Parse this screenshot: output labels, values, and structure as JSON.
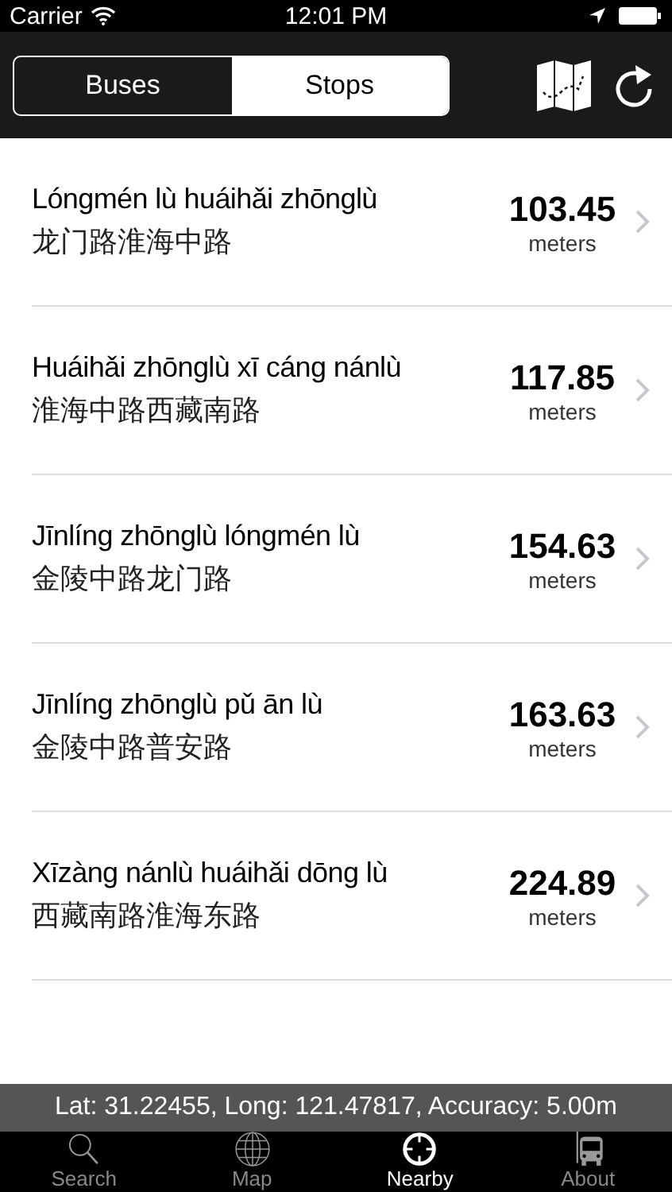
{
  "status_bar": {
    "carrier": "Carrier",
    "time": "12:01 PM"
  },
  "segments": [
    {
      "label": "Buses",
      "selected": false
    },
    {
      "label": "Stops",
      "selected": true
    }
  ],
  "stops": [
    {
      "pinyin": "Lóngmén lù huáihǎi zhōnglù",
      "hanzi": "龙门路淮海中路",
      "distance": "103.45",
      "unit": "meters"
    },
    {
      "pinyin": "Huáihǎi zhōnglù xī cáng nánlù",
      "hanzi": "淮海中路西藏南路",
      "distance": "117.85",
      "unit": "meters"
    },
    {
      "pinyin": "Jīnlíng zhōnglù lóngmén lù",
      "hanzi": "金陵中路龙门路",
      "distance": "154.63",
      "unit": "meters"
    },
    {
      "pinyin": "Jīnlíng zhōnglù pǔ ān lù",
      "hanzi": "金陵中路普安路",
      "distance": "163.63",
      "unit": "meters"
    },
    {
      "pinyin": "Xīzàng nánlù huáihǎi dōng lù",
      "hanzi": "西藏南路淮海东路",
      "distance": "224.89",
      "unit": "meters"
    }
  ],
  "location_bar": "Lat: 31.22455, Long: 121.47817, Accuracy: 5.00m",
  "tabs": [
    {
      "kind": "search",
      "label": "Search",
      "selected": false
    },
    {
      "kind": "map",
      "label": "Map",
      "selected": false
    },
    {
      "kind": "nearby",
      "label": "Nearby",
      "selected": true
    },
    {
      "kind": "about",
      "label": "About",
      "selected": false
    }
  ]
}
